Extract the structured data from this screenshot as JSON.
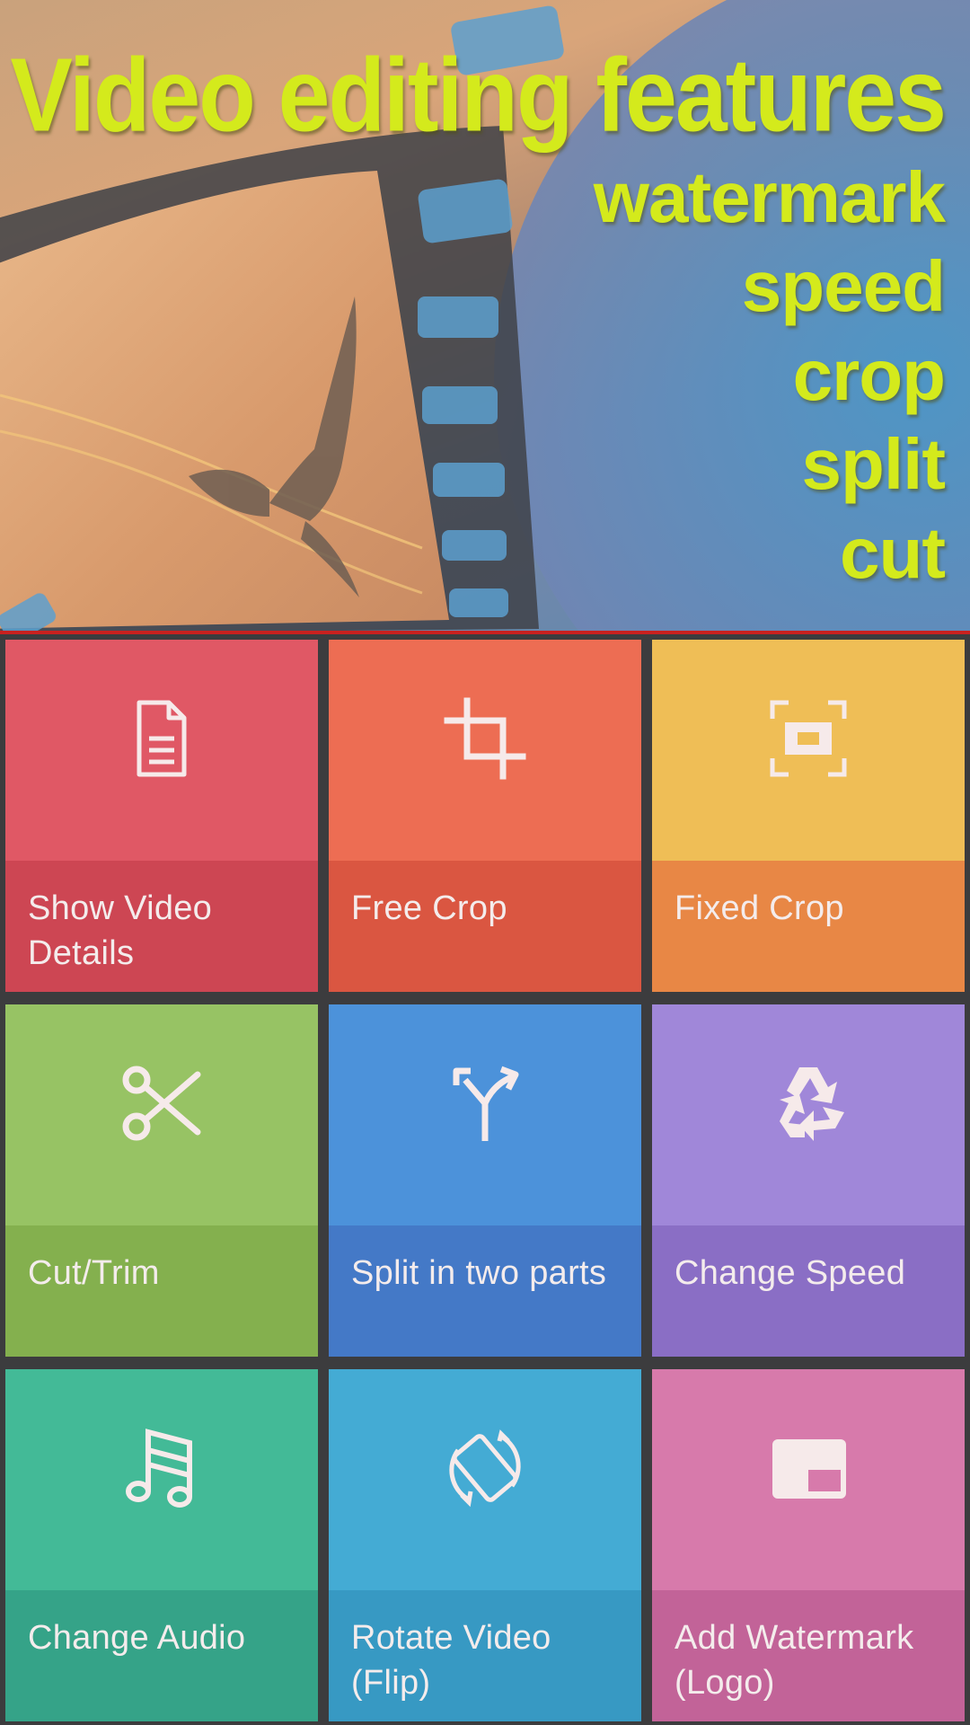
{
  "banner": {
    "headline": "Video editing features",
    "features": [
      "watermark",
      "speed",
      "crop",
      "split",
      "cut"
    ]
  },
  "tiles": [
    {
      "label": "Show Video Details",
      "icon": "document-icon",
      "top_color": "#e05865",
      "bottom_color": "#cd4653"
    },
    {
      "label": "Free Crop",
      "icon": "crop-icon",
      "top_color": "#ed6d53",
      "bottom_color": "#da5641"
    },
    {
      "label": "Fixed Crop",
      "icon": "fixed-crop-icon",
      "top_color": "#efbe56",
      "bottom_color": "#e88745"
    },
    {
      "label": "Cut/Trim",
      "icon": "scissors-icon",
      "top_color": "#97c364",
      "bottom_color": "#84b04e"
    },
    {
      "label": "Split in two parts",
      "icon": "split-arrow-icon",
      "top_color": "#4c92da",
      "bottom_color": "#4479c7"
    },
    {
      "label": "Change Speed",
      "icon": "recycle-icon",
      "top_color": "#a087d9",
      "bottom_color": "#8a6ec5"
    },
    {
      "label": "Change Audio",
      "icon": "music-note-icon",
      "top_color": "#43ba97",
      "bottom_color": "#35a388"
    },
    {
      "label": "Rotate Video (Flip)",
      "icon": "rotate-icon",
      "top_color": "#44abd4",
      "bottom_color": "#3799c3"
    },
    {
      "label": "Add Watermark (Logo)",
      "icon": "watermark-icon",
      "top_color": "#d77aab",
      "bottom_color": "#c26398"
    }
  ]
}
